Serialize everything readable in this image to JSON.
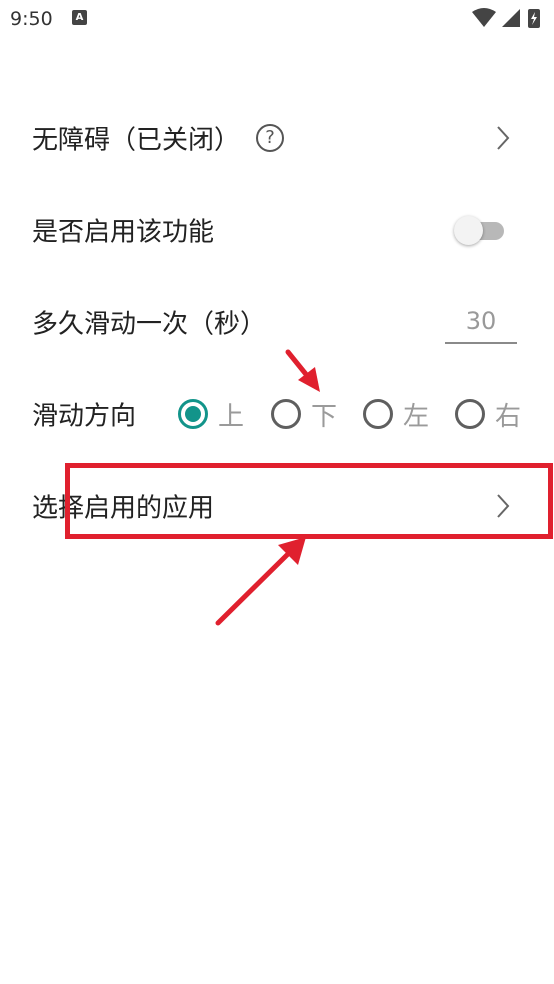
{
  "status_bar": {
    "time": "9:50",
    "notification_icon": "A",
    "icons": [
      "wifi-icon",
      "signal-icon",
      "battery-charging-icon"
    ]
  },
  "settings": {
    "accessibility": {
      "label": "无障碍（已关闭）",
      "help": "?"
    },
    "enable": {
      "label": "是否启用该功能",
      "enabled": false
    },
    "interval": {
      "label": "多久滑动一次（秒）",
      "value": "30"
    },
    "direction": {
      "label": "滑动方向",
      "options": [
        "上",
        "下",
        "左",
        "右"
      ],
      "selected": "上"
    },
    "select_apps": {
      "label": "选择启用的应用"
    }
  },
  "colors": {
    "accent": "#12948a",
    "annotation": "#e0202e",
    "text": "#222222",
    "muted_text": "#9a9a9a"
  }
}
